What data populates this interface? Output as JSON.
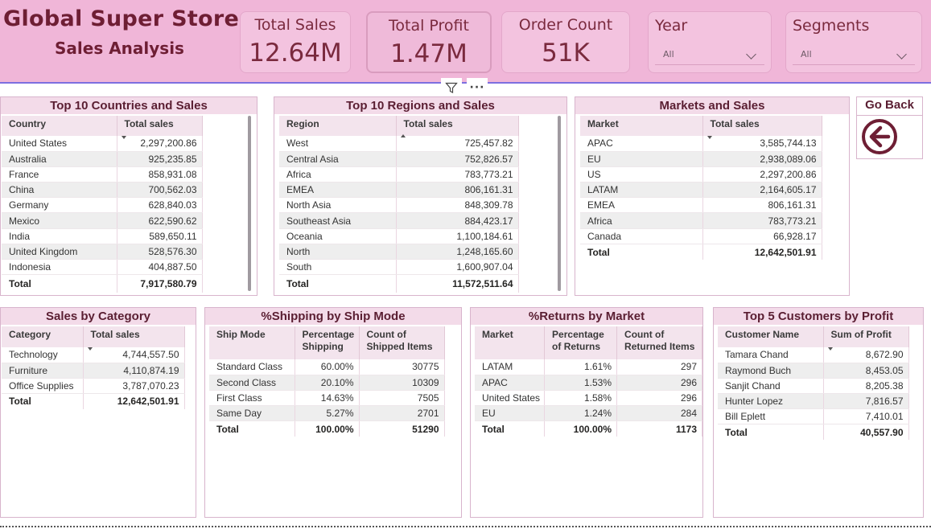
{
  "header": {
    "title": "Global Super Store",
    "subtitle": "Sales Analysis"
  },
  "cards": {
    "total_sales": {
      "label": "Total Sales",
      "value": "12.64M"
    },
    "total_profit": {
      "label": "Total Profit",
      "value": "1.47M"
    },
    "order_count": {
      "label": "Order Count",
      "value": "51K"
    }
  },
  "slicers": {
    "year": {
      "label": "Year",
      "value": "All"
    },
    "segments": {
      "label": "Segments",
      "value": "All"
    }
  },
  "visual_header": {
    "filter_icon": "filter-icon",
    "more": "···"
  },
  "countries": {
    "title": "Top 10 Countries and Sales",
    "columns": [
      "Country",
      "Total sales"
    ],
    "rows": [
      [
        "United States",
        "2,297,200.86"
      ],
      [
        "Australia",
        "925,235.85"
      ],
      [
        "France",
        "858,931.08"
      ],
      [
        "China",
        "700,562.03"
      ],
      [
        "Germany",
        "628,840.03"
      ],
      [
        "Mexico",
        "622,590.62"
      ],
      [
        "India",
        "589,650.11"
      ],
      [
        "United Kingdom",
        "528,576.30"
      ],
      [
        "Indonesia",
        "404,887.50"
      ]
    ],
    "total": [
      "Total",
      "7,917,580.79"
    ]
  },
  "regions": {
    "title": "Top 10 Regions and Sales",
    "columns": [
      "Region",
      "Total sales"
    ],
    "rows": [
      [
        "West",
        "725,457.82"
      ],
      [
        "Central Asia",
        "752,826.57"
      ],
      [
        "Africa",
        "783,773.21"
      ],
      [
        "EMEA",
        "806,161.31"
      ],
      [
        "North Asia",
        "848,309.78"
      ],
      [
        "Southeast Asia",
        "884,423.17"
      ],
      [
        "Oceania",
        "1,100,184.61"
      ],
      [
        "North",
        "1,248,165.60"
      ],
      [
        "South",
        "1,600,907.04"
      ]
    ],
    "total": [
      "Total",
      "11,572,511.64"
    ]
  },
  "markets": {
    "title": "Markets and Sales",
    "columns": [
      "Market",
      "Total sales"
    ],
    "rows": [
      [
        "APAC",
        "3,585,744.13"
      ],
      [
        "EU",
        "2,938,089.06"
      ],
      [
        "US",
        "2,297,200.86"
      ],
      [
        "LATAM",
        "2,164,605.17"
      ],
      [
        "EMEA",
        "806,161.31"
      ],
      [
        "Africa",
        "783,773.21"
      ],
      [
        "Canada",
        "66,928.17"
      ]
    ],
    "total": [
      "Total",
      "12,642,501.91"
    ]
  },
  "goback": {
    "label": "Go Back",
    "icon": "arrow-left-circle-icon"
  },
  "category": {
    "title": "Sales by Category",
    "columns": [
      "Category",
      "Total sales"
    ],
    "rows": [
      [
        "Technology",
        "4,744,557.50"
      ],
      [
        "Furniture",
        "4,110,874.19"
      ],
      [
        "Office Supplies",
        "3,787,070.23"
      ]
    ],
    "total": [
      "Total",
      "12,642,501.91"
    ]
  },
  "shipping": {
    "title": "%Shipping by Ship Mode",
    "columns": [
      "Ship Mode",
      "Percentage Shipping",
      "Count of Shipped Items"
    ],
    "rows": [
      [
        "Standard Class",
        "60.00%",
        "30775"
      ],
      [
        "Second Class",
        "20.10%",
        "10309"
      ],
      [
        "First Class",
        "14.63%",
        "7505"
      ],
      [
        "Same Day",
        "5.27%",
        "2701"
      ]
    ],
    "total": [
      "Total",
      "100.00%",
      "51290"
    ]
  },
  "returns": {
    "title": "%Returns by Market",
    "columns": [
      "Market",
      "Percentage of Returns",
      "Count of Returned Items"
    ],
    "rows": [
      [
        "LATAM",
        "1.61%",
        "297"
      ],
      [
        "APAC",
        "1.53%",
        "296"
      ],
      [
        "United States",
        "1.58%",
        "296"
      ],
      [
        "EU",
        "1.24%",
        "284"
      ]
    ],
    "total": [
      "Total",
      "100.00%",
      "1173"
    ]
  },
  "customers": {
    "title": "Top 5 Customers by Profit",
    "columns": [
      "Customer Name",
      "Sum of Profit"
    ],
    "rows": [
      [
        "Tamara Chand",
        "8,672.90"
      ],
      [
        "Raymond Buch",
        "8,453.05"
      ],
      [
        "Sanjit Chand",
        "8,205.38"
      ],
      [
        "Hunter Lopez",
        "7,816.57"
      ],
      [
        "Bill Eplett",
        "7,410.01"
      ]
    ],
    "total": [
      "Total",
      "40,557.90"
    ]
  },
  "colors": {
    "header_bg": "#f0b6d8",
    "title_text": "#6e1e34",
    "panel_title_bg": "#f3dbe9"
  }
}
